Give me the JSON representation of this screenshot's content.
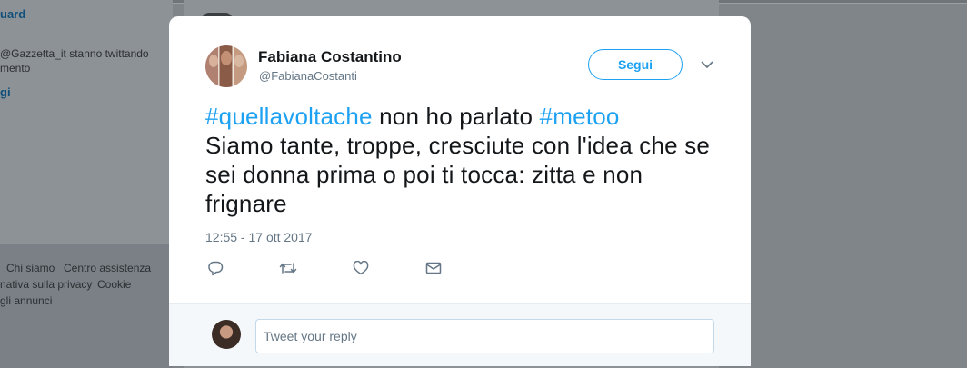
{
  "background": {
    "sidebar_link_top": "uard",
    "trend_text_line1": "@Gazzetta_it stanno twittando",
    "trend_text_line2": "mento",
    "sidebar_link_more": "gi",
    "footer_links": [
      "Chi siamo",
      "Centro assistenza"
    ],
    "footer_links_2": [
      "nativa sulla privacy",
      "Cookie"
    ],
    "footer_links_3": [
      "gli annunci"
    ]
  },
  "tweet": {
    "display_name": "Fabiana Costantino",
    "handle": "@FabianaCostanti",
    "follow_label": "Segui",
    "hashtag_1": "#quellavoltache",
    "text_1": " non ho parlato ",
    "hashtag_2": "#metoo",
    "text_2": "Siamo tante, troppe, cresciute con l'idea che se sei donna prima o poi ti tocca: zitta e non frignare",
    "timestamp": "12:55 - 17 ott 2017",
    "icons": [
      "reply-icon",
      "retweet-icon",
      "like-icon",
      "direct-message-icon",
      "chevron-down-icon"
    ]
  },
  "reply": {
    "placeholder": "Tweet your reply"
  },
  "colors": {
    "accent": "#1da1f2",
    "text": "#14171a",
    "muted": "#657786"
  }
}
